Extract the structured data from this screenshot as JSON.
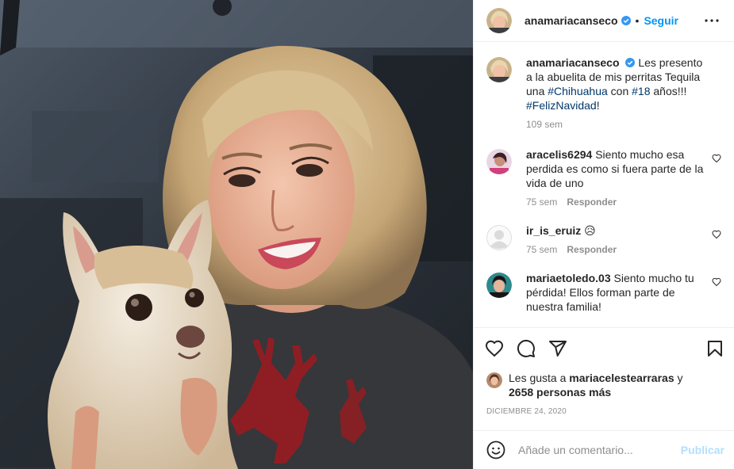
{
  "post": {
    "username": "anamariacanseco",
    "follow_label": "Seguir",
    "dot": "•",
    "caption": {
      "before": "Les presento a la abuelita de mis perritas Tequila una ",
      "tag1": "#Chihuahua",
      "mid": " con ",
      "tag2": "#18",
      "after": " años!!! ",
      "tag3": "#FelizNavidad",
      "end": "!",
      "time": "109 sem"
    },
    "comments": [
      {
        "user": "aracelis6294",
        "text": "Siento mucho esa perdida es como si fuera parte de la vida de uno",
        "time": "75 sem",
        "reply": "Responder"
      },
      {
        "user": "ir_is_eruiz",
        "text": "😥",
        "time": "75 sem",
        "reply": "Responder"
      },
      {
        "user": "mariaetoledo.03",
        "text": "Siento mucho tu pérdida! Ellos forman parte de nuestra familia!",
        "time": "",
        "reply": ""
      }
    ],
    "likes": {
      "prefix": "Les gusta a ",
      "user": "mariacelestearraras",
      "and": " y",
      "count": "2658 personas más"
    },
    "date": "DICIEMBRE 24, 2020",
    "comment_placeholder": "Añade un comentario...",
    "publish_label": "Publicar"
  },
  "colors": {
    "link": "#0095f6",
    "hashtag": "#00376b",
    "muted": "#8e8e8e",
    "publish_disabled": "#b2dffc"
  },
  "icons": {
    "more": "more-icon",
    "verified": "verified-badge-icon",
    "like": "heart-icon",
    "comment": "comment-icon",
    "share": "share-icon",
    "save": "bookmark-icon",
    "emoji": "emoji-icon"
  }
}
